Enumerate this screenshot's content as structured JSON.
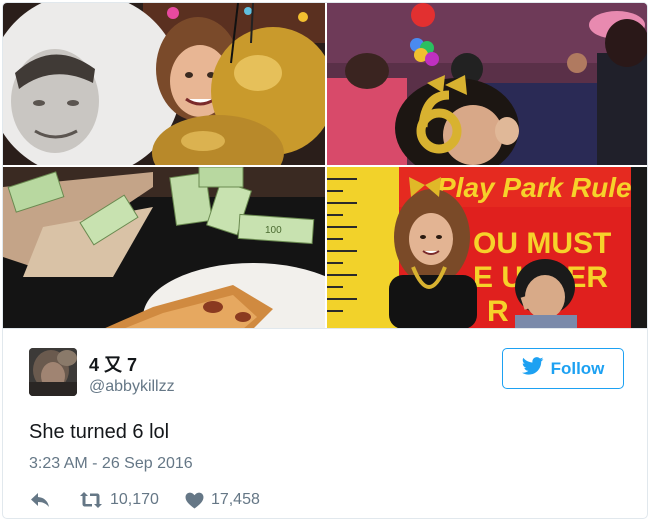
{
  "tweet": {
    "display_name": "4 又 7",
    "username": "@abbykillzz",
    "follow_label": "Follow",
    "text": "She turned 6 lol",
    "timestamp": "3:23 AM - 26 Sep 2016",
    "retweets": "10,170",
    "likes": "17,458"
  },
  "photos": {
    "photo3_bill_label": "100",
    "photo4_sign_title": "Play Park Rules",
    "photo4_sign_line1": "OU MUST",
    "photo4_sign_line2": "E UNDER",
    "photo4_sign_line3": "R"
  },
  "colors": {
    "accent": "#1da1f2",
    "text": "#14171a",
    "muted": "#657786",
    "border": "#e1e8ed"
  },
  "icons": {
    "follow": "twitter-bird-icon",
    "reply": "reply-arrow-icon",
    "retweet": "retweet-icon",
    "like": "heart-icon"
  }
}
